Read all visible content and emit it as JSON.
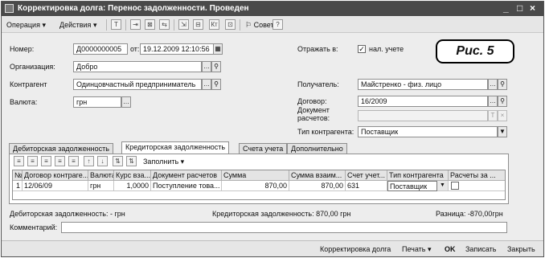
{
  "window": {
    "title": "Корректировка долга: Перенос задолженности. Проведен",
    "controls": [
      "_",
      "□",
      "×"
    ]
  },
  "toolbar": {
    "operation": "Операция",
    "actions": "Действия",
    "dropdown_glyph": "▾",
    "tips": "Советы",
    "help": "?"
  },
  "header": {
    "number_label": "Номер:",
    "number_value": "Д0000000005",
    "date_label": "от:",
    "date_value": "19.12.2009 12:10:56",
    "org_label": "Организация:",
    "org_value": "Добро",
    "contractor_label": "Контрагент",
    "contractor_value": "Одинцовчастный предприниматель",
    "currency_label": "Валюта:",
    "currency_value": "грн",
    "reflect_label": "Отражать в:",
    "tax_label": "нал. учете",
    "tax_checked": "✓",
    "receiver_label": "Получатель:",
    "receiver_value": "Майстренко - физ. лицо",
    "contract_label": "Договор:",
    "contract_value": "16/2009",
    "doc_label": "Документ расчетов:",
    "contractor_type_label": "Тип контрагента:",
    "contractor_type_value": "Поставщик"
  },
  "annotation": {
    "label": "Рис. 5"
  },
  "tabs": [
    {
      "label": "Дебиторская задолженность",
      "active": false
    },
    {
      "label": "Кредиторская задолженность",
      "active": true
    },
    {
      "label": "Счета учета",
      "active": false
    },
    {
      "label": "Дополнительно",
      "active": false
    }
  ],
  "grid_toolbar": {
    "fill_label": "Заполнить ▾"
  },
  "grid": {
    "columns": [
      "№",
      "Договор контраге...",
      "Валюта",
      "Курс вза...",
      "Документ расчетов",
      "Сумма",
      "Сумма взаим...",
      "Счет учет...",
      "Тип контрагента",
      "Расчеты за ..."
    ],
    "rows": [
      [
        "1",
        "12/06/09",
        "грн",
        "1,0000",
        "Поступление това...",
        "870,00",
        "870,00",
        "631",
        "Поставщик",
        ""
      ]
    ]
  },
  "summary": {
    "debit": "Дебиторская задолженность: - грн",
    "credit": "Кредиторская задолженность: 870,00 грн",
    "difference": "Разница: -870,00грн"
  },
  "comment": {
    "label": "Комментарий:",
    "value": ""
  },
  "bottom": {
    "correction": "Корректировка долга",
    "print": "Печать ▾",
    "ok": "OK",
    "save": "Записать",
    "close": "Закрыть"
  }
}
